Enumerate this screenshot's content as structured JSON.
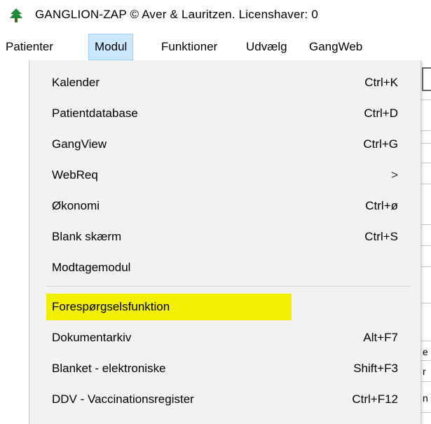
{
  "window": {
    "title": "GANGLION-ZAP  © Aver & Lauritzen.  Licenshaver: 0"
  },
  "menubar": {
    "items": [
      {
        "label": "Patienter"
      },
      {
        "label": "Modul"
      },
      {
        "label": "Funktioner"
      },
      {
        "label": "Udvælg"
      },
      {
        "label": "GangWeb"
      }
    ],
    "active_index": 1
  },
  "dropdown": {
    "items": [
      {
        "label": "Kalender",
        "shortcut": "Ctrl+K"
      },
      {
        "label": "Patientdatabase",
        "shortcut": "Ctrl+D"
      },
      {
        "label": "GangView",
        "shortcut": "Ctrl+G"
      },
      {
        "label": "WebReq",
        "submenu_arrow": ">"
      },
      {
        "label": "Økonomi",
        "shortcut": "Ctrl+ø"
      },
      {
        "label": "Blank skærm",
        "shortcut": "Ctrl+S"
      },
      {
        "label": "Modtagemodul",
        "shortcut": ""
      },
      {
        "label": "Forespørgselsfunktion",
        "shortcut": "",
        "highlight_color": "#f2ef00"
      },
      {
        "label": "Dokumentarkiv",
        "shortcut": "Alt+F7"
      },
      {
        "label": "Blanket - elektroniske",
        "shortcut": "Shift+F3"
      },
      {
        "label": "DDV - Vaccinationsregister",
        "shortcut": "Ctrl+F12"
      }
    ]
  },
  "background_glyphs": [
    "e",
    "r",
    "n"
  ],
  "colors": {
    "menu_active_bg": "#cce8ff",
    "menu_active_border": "#99d1ff",
    "dropdown_bg": "#f2f2f2",
    "highlight": "#f2ef00",
    "icon_green": "#1f8a3a"
  },
  "icons": {
    "app_icon": "tree-icon"
  }
}
